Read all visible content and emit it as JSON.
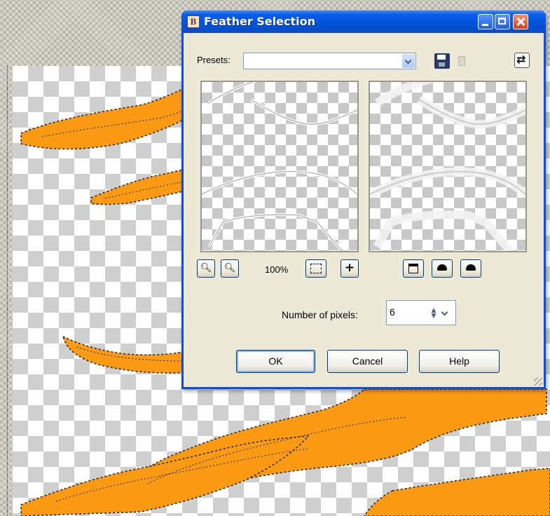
{
  "dialog": {
    "title": "Feather Selection",
    "app_icon_letter": "B"
  },
  "presets": {
    "label": "Presets:",
    "value": ""
  },
  "zoom": {
    "value": "100%"
  },
  "pixels": {
    "label": "Number of pixels:",
    "value": "6"
  },
  "buttons": {
    "ok": "OK",
    "cancel": "Cancel",
    "help": "Help"
  },
  "colors": {
    "flame": "#fb9a14",
    "title_bar": "#0052d6",
    "dialog_face": "#ece9d8"
  },
  "icons": {
    "save": "save-preset-icon",
    "delete": "delete-preset-icon",
    "reset": "reset-defaults-icon",
    "zoom_out": "zoom-out-icon",
    "zoom_in": "zoom-in-icon",
    "fit": "zoom-to-fit-icon",
    "pan": "pan-icon",
    "proof": "proof-icon",
    "auto_proof": "auto-proof-icon",
    "preview_toggle": "preview-on-image-icon"
  }
}
